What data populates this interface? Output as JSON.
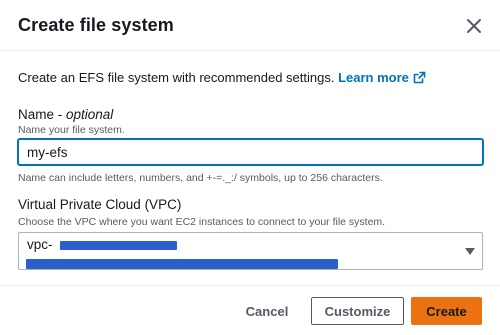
{
  "dialog": {
    "title": "Create file system",
    "intro_text": "Create an EFS file system with recommended settings. ",
    "learn_more": "Learn more"
  },
  "name_field": {
    "label": "Name - ",
    "label_optional": "optional",
    "description": "Name your file system.",
    "value": "my-efs",
    "constraint": "Name can include letters, numbers, and +-=._:/ symbols, up to 256 characters."
  },
  "vpc_field": {
    "label": "Virtual Private Cloud (VPC)",
    "description": "Choose the VPC where you want EC2 instances to connect to your file system.",
    "selected_prefix": "vpc-"
  },
  "footer": {
    "cancel_label": "Cancel",
    "customize_label": "Customize",
    "create_label": "Create"
  },
  "colors": {
    "link": "#0073bb",
    "primary_button": "#ec7211",
    "redaction": "#2b5fcb"
  },
  "icons": [
    "close-icon",
    "external-link-icon",
    "caret-down-icon"
  ]
}
